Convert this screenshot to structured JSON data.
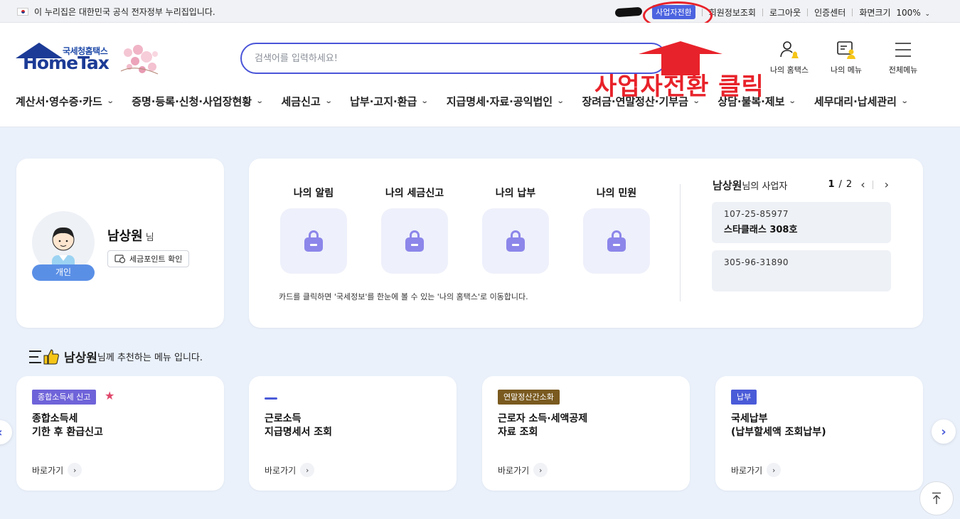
{
  "gov_banner": {
    "text": "이 누리집은 대한민국 공식 전자정부 누리집입니다.",
    "switch_label": "사업자전환",
    "links": [
      "회원정보조회",
      "로그아웃",
      "인증센터"
    ],
    "zoom_label": "화면크기",
    "zoom_value": "100%"
  },
  "logo": {
    "ko": "국세청홈택스",
    "en": "HomeTax"
  },
  "search": {
    "placeholder": "검색어를 입력하세요!"
  },
  "header_icons": [
    {
      "label": "나의 홈택스",
      "icon": "user-bell-icon"
    },
    {
      "label": "나의 메뉴",
      "icon": "menu-card-icon"
    },
    {
      "label": "전체메뉴",
      "icon": "hamburger-icon"
    }
  ],
  "gnb": [
    "계산서·영수증·카드",
    "증명·등록·신청·사업장현황",
    "세금신고",
    "납부·고지·환급",
    "지급명세·자료·공익법인",
    "장려금·연말정산·기부금",
    "상담·불복·제보",
    "세무대리·납세관리"
  ],
  "annotation": {
    "text": "사업자전환 클릭",
    "color": "#e8222a"
  },
  "profile": {
    "name": "남상원",
    "suffix": "님",
    "type_badge": "개인",
    "point_button": "세금포인트 확인"
  },
  "my_status": {
    "tiles": [
      "나의 알림",
      "나의 세금신고",
      "나의 납부",
      "나의 민원"
    ],
    "note": "카드를 클릭하면 '국세정보'를 한눈에 볼 수 있는 '나의 홈택스'로 이동합니다.",
    "biz_owner": "남상원",
    "biz_owner_suffix": "님의 사업자",
    "page_current": "1",
    "page_total": "2",
    "businesses": [
      {
        "number": "107-25-85977",
        "name": "스타클래스 308호"
      },
      {
        "number": "305-96-31890",
        "name": ""
      }
    ]
  },
  "recommend": {
    "name": "남상원",
    "suffix": "님께 추천하는 메뉴 입니다.",
    "go_label": "바로가기",
    "cards": [
      {
        "tag": "종합소득세 신고",
        "tag_color": "#6f63d9",
        "title": "종합소득세\n기한 후 환급신고",
        "starred": true
      },
      {
        "tag": "",
        "tag_color": "#4a5bd8",
        "title": "근로소득\n지급명세서 조회",
        "starred": false
      },
      {
        "tag": "연말정산간소화",
        "tag_color": "#7a5a1f",
        "title": "근로자 소득·세액공제\n자료 조회",
        "starred": false
      },
      {
        "tag": "납부",
        "tag_color": "#4a5bd8",
        "title": "국세납부\n(납부할세액 조회납부)",
        "starred": false
      }
    ]
  },
  "colors": {
    "accent": "#4a55d8",
    "page_bg": "#eaf1fb",
    "navy": "#1c3b96"
  }
}
